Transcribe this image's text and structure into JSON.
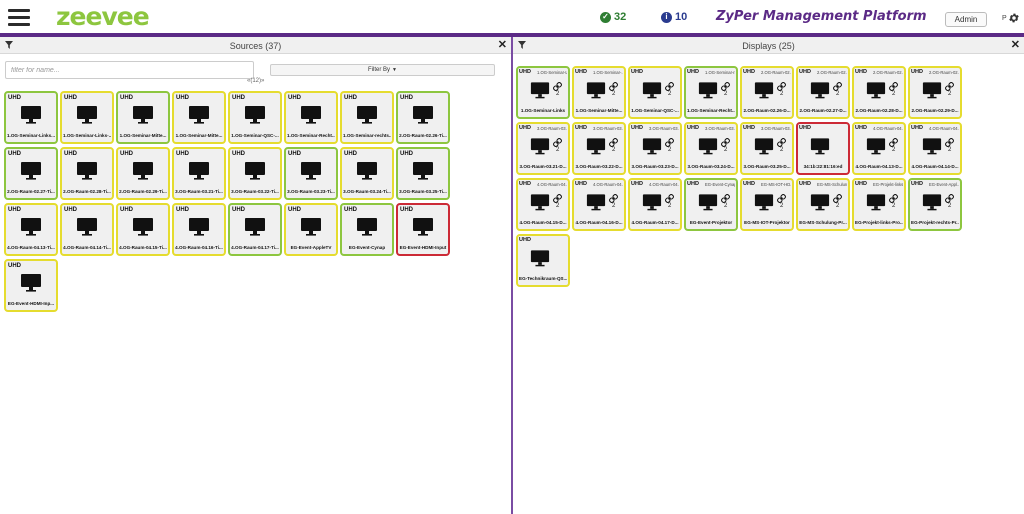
{
  "header": {
    "logo": "zeevee",
    "status_ok": "32",
    "status_info": "10",
    "app_title": "ZyPer Management Platform",
    "admin_label": "Admin",
    "p_label": "P"
  },
  "sources": {
    "title": "Sources (37)",
    "filter_placeholder": "filter for name...",
    "filterby_label": "Filter By",
    "pager": "«(12)»",
    "tiles": [
      {
        "tag": "UHD",
        "name": "1.OG-Seminar-Links...",
        "status": "green"
      },
      {
        "tag": "UHD",
        "name": "1.OG-Seminar-Links-...",
        "status": "yellow"
      },
      {
        "tag": "UHD",
        "name": "1.OG-Seminar-Mitte...",
        "status": "green"
      },
      {
        "tag": "UHD",
        "name": "1.OG-Seminar-Mitte...",
        "status": "yellow"
      },
      {
        "tag": "UHD",
        "name": "1.OG-Seminar-QSC-...",
        "status": "yellow"
      },
      {
        "tag": "UHD",
        "name": "1.OG-Seminar-Recht...",
        "status": "yellow"
      },
      {
        "tag": "UHD",
        "name": "1.OG-Seminar-rechts...",
        "status": "yellow"
      },
      {
        "tag": "UHD",
        "name": "2.OG-Raum-02.26-Ti...",
        "status": "green"
      },
      {
        "tag": "UHD",
        "name": "2.OG-Raum-02.27-Ti...",
        "status": "green"
      },
      {
        "tag": "UHD",
        "name": "2.OG-Raum-02.28-Ti...",
        "status": "yellow"
      },
      {
        "tag": "UHD",
        "name": "2.OG-Raum-02.29-Ti...",
        "status": "yellow"
      },
      {
        "tag": "UHD",
        "name": "3.OG-Raum-03.21-Ti...",
        "status": "yellow"
      },
      {
        "tag": "UHD",
        "name": "3.OG-Raum-03.22-Ti...",
        "status": "yellow"
      },
      {
        "tag": "UHD",
        "name": "3.OG-Raum-03.23-Ti...",
        "status": "green"
      },
      {
        "tag": "UHD",
        "name": "3.OG-Raum-03.24-Ti...",
        "status": "yellow"
      },
      {
        "tag": "UHD",
        "name": "3.OG-Raum-03.25-Ti...",
        "status": "green"
      },
      {
        "tag": "UHD",
        "name": "4.OG-Raum-04.13-Ti...",
        "status": "yellow"
      },
      {
        "tag": "UHD",
        "name": "4.OG-Raum-04.14-Ti...",
        "status": "yellow"
      },
      {
        "tag": "UHD",
        "name": "4.OG-Raum-04.15-Ti...",
        "status": "yellow"
      },
      {
        "tag": "UHD",
        "name": "4.OG-Raum-04.16-Ti...",
        "status": "yellow"
      },
      {
        "tag": "UHD",
        "name": "4.OG-Raum-04.17-Ti...",
        "status": "green"
      },
      {
        "tag": "UHD",
        "name": "EG-Event-AppleTV",
        "status": "yellow"
      },
      {
        "tag": "UHD",
        "name": "EG-Event-Cynap",
        "status": "green"
      },
      {
        "tag": "UHD",
        "name": "EG-Event-HDMI-Input",
        "status": "red"
      },
      {
        "tag": "UHD",
        "name": "EG-Event-HDMI-Inp...",
        "status": "yellow"
      }
    ]
  },
  "displays": {
    "title": "Displays (25)",
    "tiles": [
      {
        "tag": "UHD",
        "src": "1.OG-Seminar-Li...",
        "name": "1.OG-Seminar-Links",
        "count": "2",
        "linked": true,
        "status": "green"
      },
      {
        "tag": "UHD",
        "src": "1.OG-Seminar-...",
        "name": "1.OG-Seminar-Mitte...",
        "count": "2",
        "linked": true,
        "status": "yellow"
      },
      {
        "tag": "UHD",
        "src": "",
        "name": "1.OG-Seminar-QSC-...",
        "count": "2",
        "linked": true,
        "status": "yellow"
      },
      {
        "tag": "UHD",
        "src": "1.OG-Seminar-r...",
        "name": "1.OG-Seminar-Recht...",
        "count": "2",
        "linked": true,
        "status": "green"
      },
      {
        "tag": "UHD",
        "src": "2.OG-Raum-02...",
        "name": "2.OG-Raum-02.26-D...",
        "count": "2",
        "linked": true,
        "status": "yellow"
      },
      {
        "tag": "UHD",
        "src": "2.OG-Raum-02...",
        "name": "2.OG-Raum-02.27-D...",
        "count": "2",
        "linked": true,
        "status": "yellow"
      },
      {
        "tag": "UHD",
        "src": "2.OG-Raum-02...",
        "name": "2.OG-Raum-02.28-D...",
        "count": "2",
        "linked": true,
        "status": "yellow"
      },
      {
        "tag": "UHD",
        "src": "2.OG-Raum-02...",
        "name": "2.OG-Raum-02.29-D...",
        "count": "2",
        "linked": true,
        "status": "yellow"
      },
      {
        "tag": "UHD",
        "src": "3.OG-Raum-03...",
        "name": "3.OG-Raum-03.21-D...",
        "count": "2",
        "linked": true,
        "status": "yellow"
      },
      {
        "tag": "UHD",
        "src": "3.OG-Raum-03...",
        "name": "3.OG-Raum-03.22-D...",
        "count": "2",
        "linked": true,
        "status": "yellow"
      },
      {
        "tag": "UHD",
        "src": "3.OG-Raum-03...",
        "name": "3.OG-Raum-03.23-D...",
        "count": "2",
        "linked": true,
        "status": "yellow"
      },
      {
        "tag": "UHD",
        "src": "3.OG-Raum-03...",
        "name": "3.OG-Raum-03.24-D...",
        "count": "2",
        "linked": true,
        "status": "yellow"
      },
      {
        "tag": "UHD",
        "src": "3.OG-Raum-03...",
        "name": "3.OG-Raum-03.25-D...",
        "count": "2",
        "linked": true,
        "status": "yellow"
      },
      {
        "tag": "UHD",
        "src": "",
        "name": "34:1b:22:81:16:ed",
        "count": "",
        "linked": false,
        "status": "red"
      },
      {
        "tag": "UHD",
        "src": "4.OG-Raum-04...",
        "name": "4.OG-Raum-04.13-D...",
        "count": "2",
        "linked": true,
        "status": "yellow"
      },
      {
        "tag": "UHD",
        "src": "4.OG-Raum-04...",
        "name": "4.OG-Raum-04.14-D...",
        "count": "2",
        "linked": true,
        "status": "yellow"
      },
      {
        "tag": "UHD",
        "src": "4.OG-Raum-04...",
        "name": "4.OG-Raum-04.15-D...",
        "count": "2",
        "linked": true,
        "status": "yellow"
      },
      {
        "tag": "UHD",
        "src": "4.OG-Raum-04...",
        "name": "4.OG-Raum-04.16-D...",
        "count": "2",
        "linked": true,
        "status": "yellow"
      },
      {
        "tag": "UHD",
        "src": "4.OG-Raum-04...",
        "name": "4.OG-Raum-04.17-D...",
        "count": "2",
        "linked": true,
        "status": "yellow"
      },
      {
        "tag": "UHD",
        "src": "EG-Event-Cynap",
        "name": "EG-Event-Projektor",
        "count": "2",
        "linked": true,
        "status": "green"
      },
      {
        "tag": "UHD",
        "src": "EG-MS-IOT-HD...",
        "name": "EG-MS-IOT-Projektor",
        "count": "2",
        "linked": true,
        "status": "yellow"
      },
      {
        "tag": "UHD",
        "src": "EG-MS-Schulun...",
        "name": "EG-MS-Schulung-Pr...",
        "count": "2",
        "linked": true,
        "status": "yellow"
      },
      {
        "tag": "UHD",
        "src": "EG-Projekt-links-...",
        "name": "EG-Projekt-links-Pro...",
        "count": "2",
        "linked": true,
        "status": "yellow"
      },
      {
        "tag": "UHD",
        "src": "EG-Event-Appl...",
        "name": "EG-Projekt-rechts-Pr...",
        "count": "2",
        "linked": true,
        "status": "green"
      },
      {
        "tag": "UHD",
        "src": "",
        "name": "EG-Technikraum-QS...",
        "count": "",
        "linked": false,
        "status": "yellow"
      }
    ]
  },
  "colors": {
    "brand_purple": "#5b2a86",
    "brand_green": "#8dc63f",
    "status_green": "#8dc63f",
    "status_yellow": "#e5dc2f",
    "status_red": "#cc2a36"
  }
}
